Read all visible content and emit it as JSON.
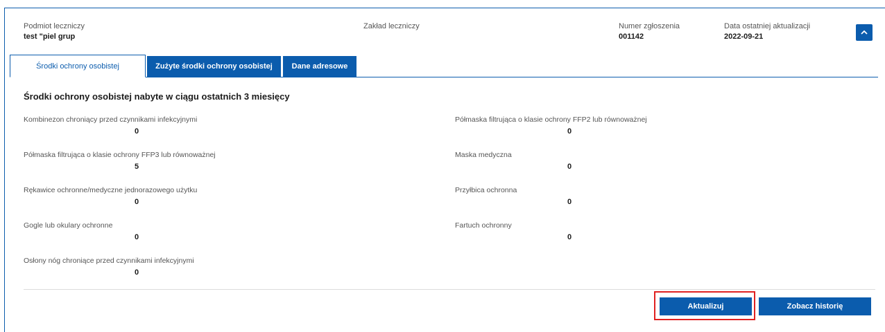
{
  "header": {
    "podmiot_label": "Podmiot leczniczy",
    "podmiot_value": "test \"piel grup",
    "zaklad_label": "Zakład leczniczy",
    "numer_label": "Numer zgłoszenia",
    "numer_value": "001142",
    "data_label": "Data ostatniej aktualizacji",
    "data_value": "2022-09-21",
    "collapse_icon": "chevron-up-icon"
  },
  "tabs": [
    {
      "label": "Środki ochrony osobistej",
      "active": true
    },
    {
      "label": "Zużyte środki ochrony osobistej",
      "active": false
    },
    {
      "label": "Dane adresowe",
      "active": false
    }
  ],
  "section": {
    "title": "Środki ochrony osobistej nabyte w ciągu ostatnich 3 miesięcy"
  },
  "fields": [
    {
      "label": "Kombinezon chroniący przed czynnikami infekcyjnymi",
      "value": "0"
    },
    {
      "label": "Półmaska filtrująca o klasie ochrony FFP2 lub równoważnej",
      "value": "0"
    },
    {
      "label": "Półmaska filtrująca o klasie ochrony FFP3 lub równoważnej",
      "value": "5"
    },
    {
      "label": "Maska medyczna",
      "value": "0"
    },
    {
      "label": "Rękawice ochronne/medyczne jednorazowego użytku",
      "value": "0"
    },
    {
      "label": "Przyłbica ochronna",
      "value": "0"
    },
    {
      "label": "Gogle lub okulary ochronne",
      "value": "0"
    },
    {
      "label": "Fartuch ochronny",
      "value": "0"
    },
    {
      "label": "Osłony nóg chroniące przed czynnikami infekcyjnymi",
      "value": "0"
    }
  ],
  "actions": {
    "update_label": "Aktualizuj",
    "history_label": "Zobacz historię"
  },
  "colors": {
    "primary": "#0b5cad",
    "highlight": "#e02020"
  }
}
